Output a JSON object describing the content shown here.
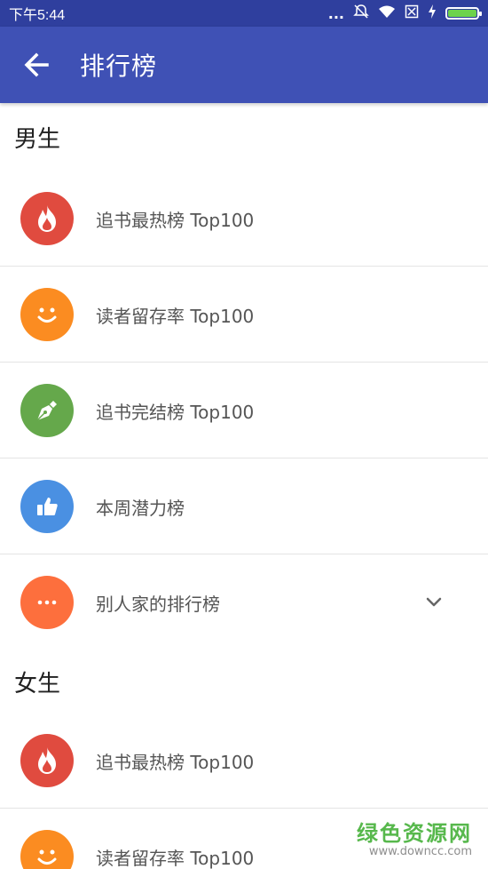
{
  "status_bar": {
    "time": "下午5:44",
    "signal_dots": "...",
    "icons": [
      "notification-muted-icon",
      "wifi-icon",
      "no-sim-icon",
      "charging-icon",
      "battery-icon"
    ]
  },
  "app_bar": {
    "title": "排行榜",
    "back_icon": "arrow-left-icon"
  },
  "colors": {
    "status_bar": "#2f3f9e",
    "app_bar": "#3f51b5",
    "fire": "#e04b3f",
    "smile": "#fb8c21",
    "pen": "#65a84b",
    "thumb": "#4a90e2",
    "more": "#fd6f3d"
  },
  "sections": [
    {
      "title": "男生",
      "items": [
        {
          "label": "追书最热榜 Top100",
          "icon": "flame-icon"
        },
        {
          "label": "读者留存率 Top100",
          "icon": "smile-icon"
        },
        {
          "label": "追书完结榜 Top100",
          "icon": "pen-nib-icon"
        },
        {
          "label": "本周潜力榜",
          "icon": "thumbs-up-icon"
        },
        {
          "label": "别人家的排行榜",
          "icon": "more-dots-icon",
          "expand_icon": "chevron-down-icon"
        }
      ]
    },
    {
      "title": "女生",
      "items": [
        {
          "label": "追书最热榜 Top100",
          "icon": "flame-icon"
        },
        {
          "label": "读者留存率 Top100",
          "icon": "smile-icon"
        }
      ]
    }
  ],
  "watermark": {
    "title": "绿色资源网",
    "url": "www.downcc.com"
  }
}
